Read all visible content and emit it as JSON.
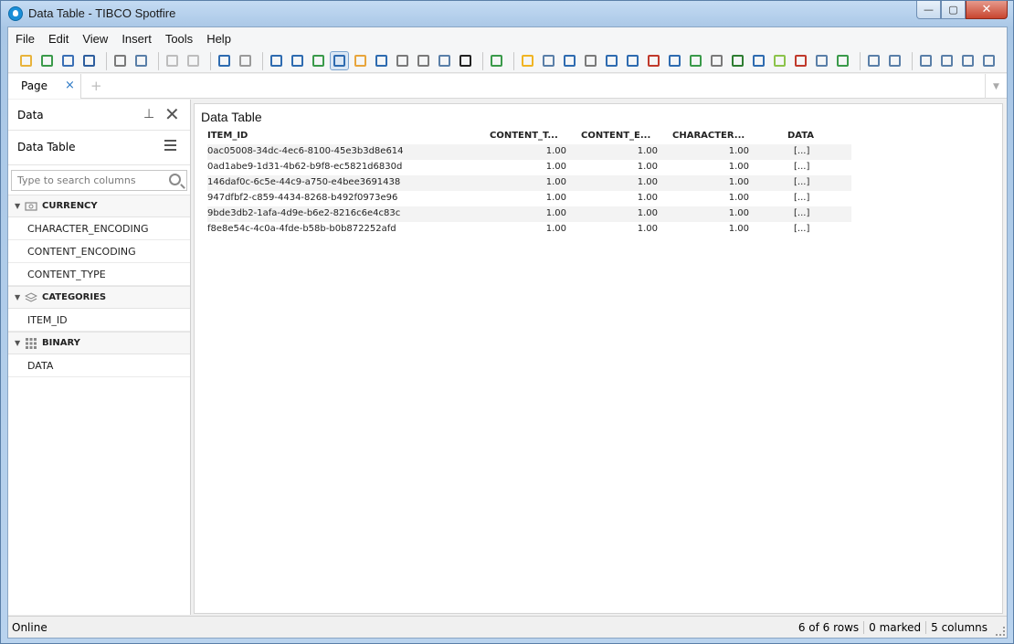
{
  "window": {
    "title": "Data Table - TIBCO Spotfire",
    "min": "—",
    "max": "▢",
    "close": "✕"
  },
  "menu": [
    "File",
    "Edit",
    "View",
    "Insert",
    "Tools",
    "Help"
  ],
  "tabs": {
    "page_label": "Page",
    "close": "×",
    "add": "+",
    "scroll": "▼"
  },
  "data_panel": {
    "title": "Data",
    "pin": "⊥",
    "close": "✕",
    "source": "Data Table",
    "search_placeholder": "Type to search columns",
    "groups": [
      {
        "label": "CURRENCY",
        "icon": "currency-icon",
        "arrow": "▼",
        "columns": [
          "CHARACTER_ENCODING",
          "CONTENT_ENCODING",
          "CONTENT_TYPE"
        ]
      },
      {
        "label": "CATEGORIES",
        "icon": "categories-icon",
        "arrow": "▼",
        "columns": [
          "ITEM_ID"
        ]
      },
      {
        "label": "BINARY",
        "icon": "binary-icon",
        "arrow": "▼",
        "columns": [
          "DATA"
        ]
      }
    ]
  },
  "viz": {
    "title": "Data Table",
    "headers": [
      "ITEM_ID",
      "CONTENT_T...",
      "CONTENT_E...",
      "CHARACTER...",
      "DATA"
    ],
    "rows": [
      [
        "0ac05008-34dc-4ec6-8100-45e3b3d8e614",
        "1.00",
        "1.00",
        "1.00",
        "[...]"
      ],
      [
        "0ad1abe9-1d31-4b62-b9f8-ec5821d6830d",
        "1.00",
        "1.00",
        "1.00",
        "[...]"
      ],
      [
        "146daf0c-6c5e-44c9-a750-e4bee3691438",
        "1.00",
        "1.00",
        "1.00",
        "[...]"
      ],
      [
        "947dfbf2-c859-4434-8268-b492f0973e96",
        "1.00",
        "1.00",
        "1.00",
        "[...]"
      ],
      [
        "9bde3db2-1afa-4d9e-b6e2-8216c6e4c83c",
        "1.00",
        "1.00",
        "1.00",
        "[...]"
      ],
      [
        "f8e8e54c-4c0a-4fde-b58b-b0b872252afd",
        "1.00",
        "1.00",
        "1.00",
        "[...]"
      ]
    ]
  },
  "status": {
    "left": "Online",
    "rows": "6 of 6 rows",
    "marked": "0 marked",
    "columns": "5 columns"
  }
}
